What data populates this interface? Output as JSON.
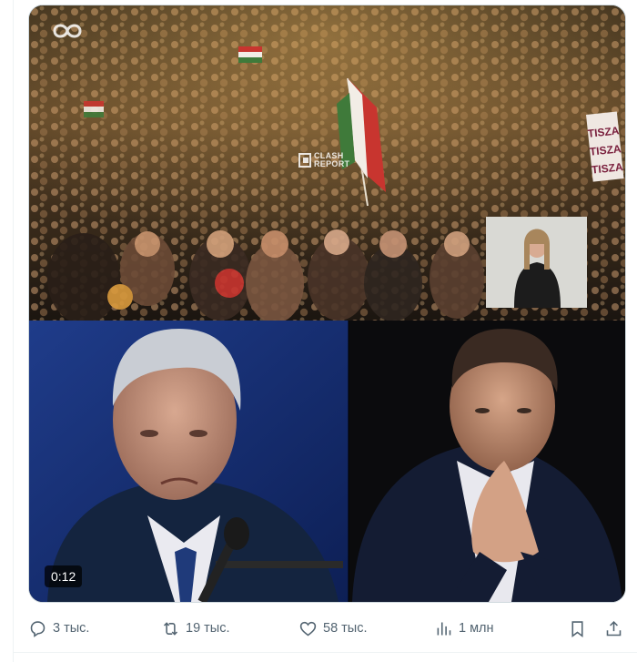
{
  "video": {
    "time": "0:12",
    "watermark_line1": "CLASH",
    "watermark_line2": "REPORT",
    "sign_text": "TISZA TISZA",
    "logo_icon": "infinity-loop-icon"
  },
  "actions": {
    "replies": "3 тыс.",
    "retweets": "19 тыс.",
    "likes": "58 тыс.",
    "views": "1 млн",
    "reply_icon": "reply-icon",
    "retweet_icon": "retweet-icon",
    "like_icon": "heart-icon",
    "views_icon": "views-icon",
    "bookmark_icon": "bookmark-icon",
    "share_icon": "share-icon"
  },
  "colors": {
    "icon_gray": "#536471",
    "border": "#cfd9de",
    "flag_red": "#c8352f",
    "flag_green": "#3f7a3a"
  }
}
